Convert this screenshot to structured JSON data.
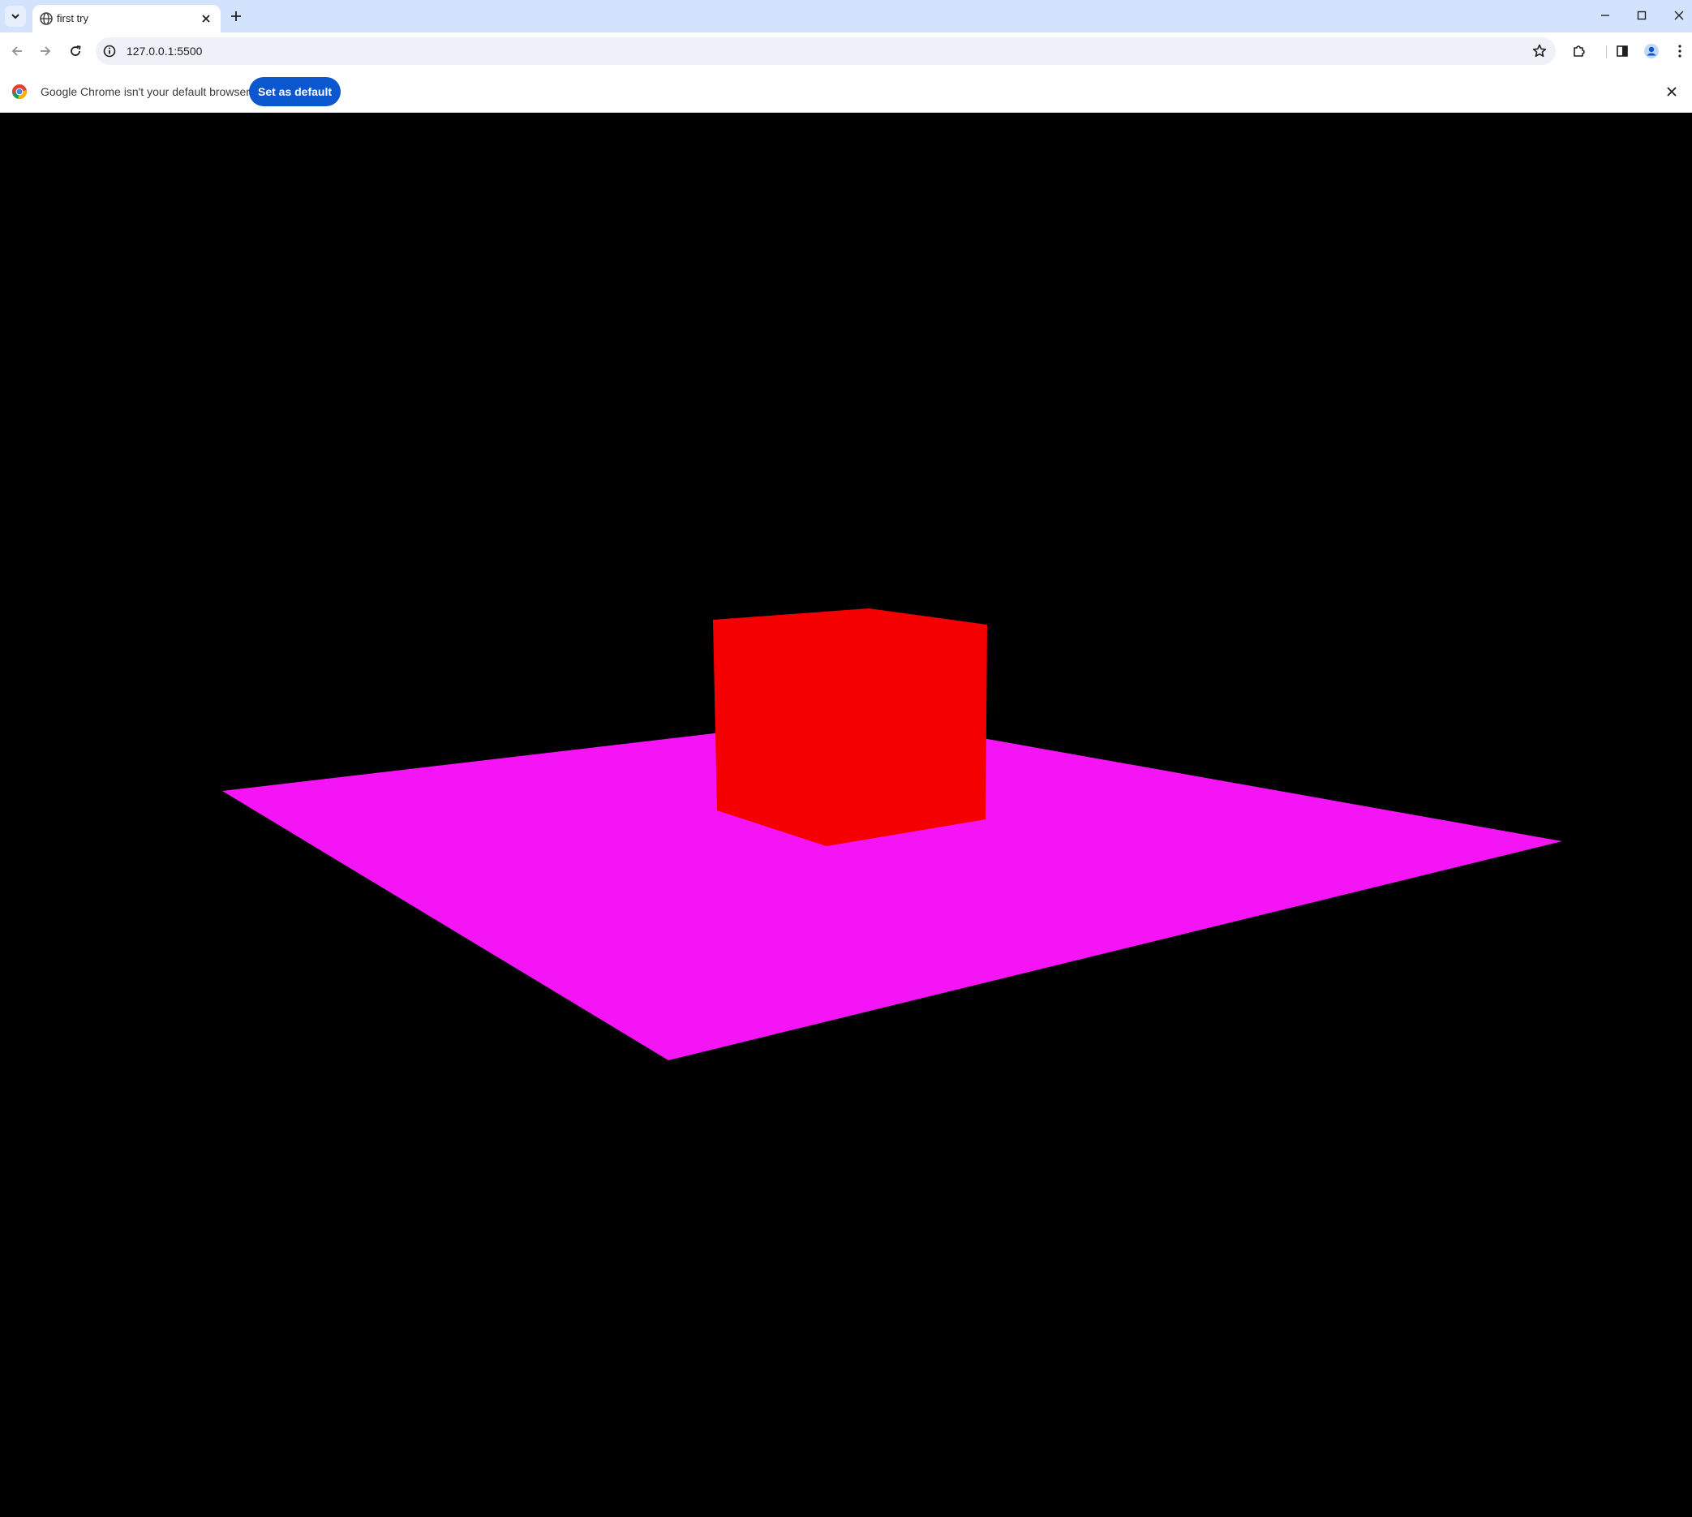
{
  "browser": {
    "tab": {
      "title": "first try"
    },
    "address": {
      "url": "127.0.0.1:5500"
    }
  },
  "infobar": {
    "message": "Google Chrome isn't your default browser",
    "button_label": "Set as default"
  },
  "scene": {
    "background": "#000000",
    "plane_color": "#f514f5",
    "cube_color": "#f50000"
  },
  "colors": {
    "tabstrip": "#d3e3fd",
    "accent": "#0b57d0"
  },
  "icons": {
    "tab_search": "chevron-down-icon",
    "favicon": "globe-icon",
    "tab_close": "close-icon",
    "new_tab": "plus-icon",
    "minimize": "minimize-icon",
    "maximize": "maximize-icon",
    "window_close": "close-icon",
    "back": "arrow-left-icon",
    "forward": "arrow-right-icon",
    "reload": "reload-icon",
    "site_info": "info-icon",
    "bookmark": "star-icon",
    "extensions": "puzzle-icon",
    "side_panel": "side-panel-icon",
    "profile": "profile-icon",
    "menu": "kebab-menu-icon",
    "chrome_logo": "chrome-logo-icon",
    "infobar_close": "close-icon"
  }
}
